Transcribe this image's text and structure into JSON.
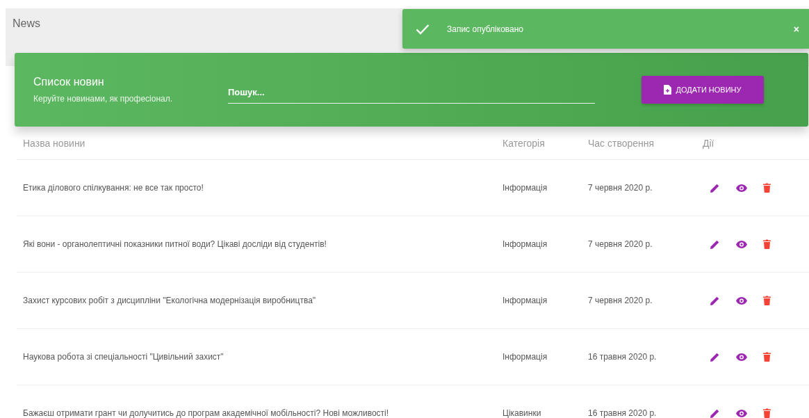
{
  "page_title": "News",
  "toast": {
    "message": "Запис опубліковано",
    "close": "×"
  },
  "header_card": {
    "title": "Список новин",
    "subtitle": "Керуйте новинами, як професіонал.",
    "search": {
      "placeholder": "Пошук..."
    },
    "add_button": "ДОДАТИ НОВИНУ"
  },
  "table": {
    "columns": [
      "Назва новини",
      "Категорія",
      "Час створення",
      "Дії"
    ],
    "rows": [
      {
        "title": "Етика ділового спілкування: не все так просто!",
        "category": "Інформація",
        "created": "7 червня 2020 р."
      },
      {
        "title": "Які вони - органолептичні показники питної води? Цікаві досліди від студентів!",
        "category": "Інформація",
        "created": "7 червня 2020 р."
      },
      {
        "title": "Захист курсових робіт з дисципліни \"Екологічна модернізація виробництва\"",
        "category": "Інформація",
        "created": "7 червня 2020 р."
      },
      {
        "title": "Наукова робота зі спеціальності \"Цивільний захист\"",
        "category": "Інформація",
        "created": "16 травня 2020 р."
      },
      {
        "title": "Бажаєш отримати грант чи долучитись до програм академічної мобільності? Нові можливості!",
        "category": "Цікавинки",
        "created": "16 травня 2020 р."
      }
    ]
  }
}
